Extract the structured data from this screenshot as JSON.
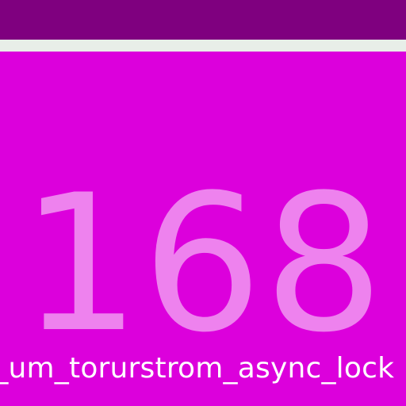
{
  "display": {
    "value": "168",
    "caption": "t_um_torurstrom_async_lock"
  },
  "colors": {
    "top_bar": "#7f007f",
    "divider": "#e8eee8",
    "panel": "#dc00dc",
    "value_text": "#ee82ee",
    "caption_text": "#ffffff"
  }
}
